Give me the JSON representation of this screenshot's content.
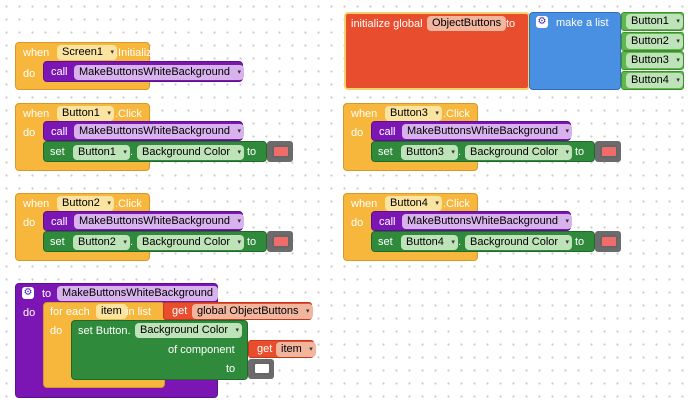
{
  "kw": {
    "when": "when",
    "do": "do",
    "call": "call",
    "set": "set",
    "to": "to",
    "click": ".Click",
    "initialize": ".Initialize",
    "dot": ".",
    "init_global": "initialize global",
    "make_a_list": "make a list",
    "for_each": "for each",
    "in_list": "in list",
    "get": "get",
    "set_button": "set Button.",
    "of_component": "of component"
  },
  "names": {
    "screen1": "Screen1",
    "button1": "Button1",
    "button2": "Button2",
    "button3": "Button3",
    "button4": "Button4",
    "procedure": "MakeButtonsWhiteBackground",
    "global_var": "ObjectButtons",
    "global_get": "global ObjectButtons",
    "item": "item",
    "bg_color": "Background Color"
  },
  "colors": {
    "event": "#f6b73c",
    "procedure_call": "#7b16b5",
    "setter": "#2f8b3b",
    "variable": "#e84e2e",
    "list": "#4a90e2",
    "component": "#5eb84c",
    "swatch_red": "#f26b6b",
    "swatch_white": "#ffffff"
  },
  "icons": {
    "dropdown": "▾",
    "gear": "⚙"
  }
}
